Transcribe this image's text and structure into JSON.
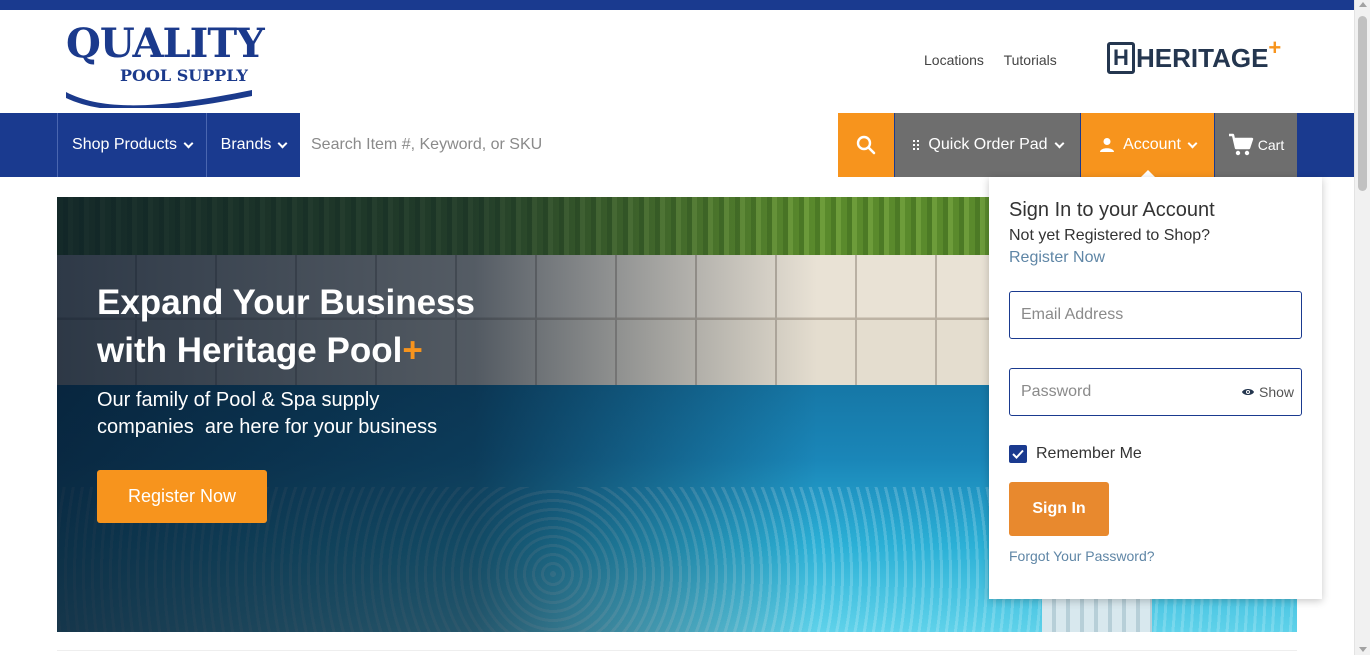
{
  "header": {
    "logo_main": "QUALITY",
    "logo_sub": "POOL SUPPLY",
    "links": [
      "Locations",
      "Tutorials"
    ],
    "partner_logo": "HERITAGE",
    "partner_logo_mark": "H",
    "partner_plus": "+"
  },
  "nav": {
    "shop_products": "Shop Products",
    "brands": "Brands",
    "search_placeholder": "Search Item #, Keyword, or SKU",
    "quick_order": "Quick Order Pad",
    "account": "Account",
    "cart": "Cart"
  },
  "hero": {
    "title_line1": "Expand Your Business",
    "title_line2": "with Heritage Pool",
    "title_plus": "+",
    "subtitle_line1": "Our family of Pool & Spa supply",
    "subtitle_line2": "companies  are here for your business",
    "cta": "Register Now"
  },
  "signin_panel": {
    "title": "Sign In to your Account",
    "not_registered": "Not yet Registered to Shop?",
    "register_link": "Register Now",
    "email_placeholder": "Email Address",
    "password_placeholder": "Password",
    "show_label": "Show",
    "remember_label": "Remember Me",
    "remember_checked": true,
    "signin_button": "Sign In",
    "forgot_link": "Forgot Your Password?"
  },
  "colors": {
    "brand_blue": "#1a3a8f",
    "accent_orange": "#f7941d",
    "nav_gray": "#6e6e6e",
    "link_blue": "#5f86a6"
  }
}
